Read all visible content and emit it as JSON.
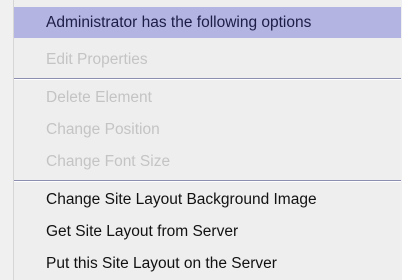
{
  "menu": {
    "header": "Administrator has the following options",
    "items": [
      {
        "label": "Edit Properties",
        "enabled": false
      },
      {
        "label": "Delete Element",
        "enabled": false
      },
      {
        "label": "Change Position",
        "enabled": false
      },
      {
        "label": "Change Font Size",
        "enabled": false
      },
      {
        "label": "Change Site Layout Background Image",
        "enabled": true
      },
      {
        "label": "Get Site Layout from Server",
        "enabled": true
      },
      {
        "label": "Put this Site Layout on the Server",
        "enabled": true
      }
    ]
  },
  "colors": {
    "header_bg": "#b4b4e2",
    "menu_bg": "#eeeeee",
    "disabled_text": "#c4c4c4",
    "enabled_text": "#111111"
  }
}
